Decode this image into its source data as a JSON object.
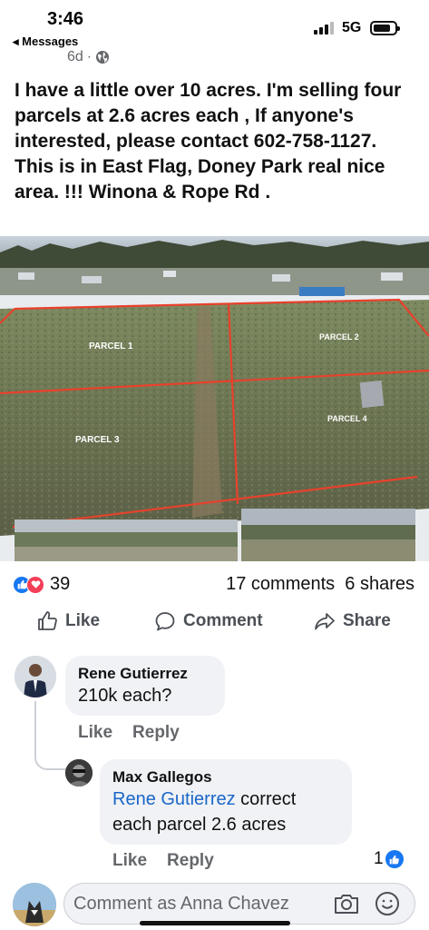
{
  "status_bar": {
    "time": "3:46",
    "back_label": "◂ Messages",
    "network": "5G"
  },
  "post": {
    "age": "6d",
    "separator": "·",
    "text": "I have a little over 10 acres. I'm selling four parcels at 2.6 acres each , If anyone's interested, please contact 602-758-1127. This is in East Flag, Doney Park real nice area. !!! Winona & Rope Rd .",
    "photo_labels": {
      "parcel1": "PARCEL 1",
      "parcel2": "PARCEL 2",
      "parcel3": "PARCEL 3",
      "parcel4": "PARCEL 4"
    },
    "reaction_count": "39",
    "comments_shares": "17 comments  6 shares"
  },
  "actions": {
    "like": "Like",
    "comment": "Comment",
    "share": "Share"
  },
  "comments": [
    {
      "name": "Rene Gutierrez",
      "text": "210k each?",
      "like": "Like",
      "reply": "Reply"
    },
    {
      "name": "Max Gallegos",
      "mention": "Rene Gutierrez",
      "text_after_mention": " correct",
      "text_line2": "each parcel 2.6 acres",
      "like": "Like",
      "reply": "Reply",
      "like_count": "1"
    }
  ],
  "composer": {
    "placeholder": "Comment as Anna Chavez"
  },
  "colors": {
    "accent_blue": "#1877f2",
    "love_red": "#f33e58",
    "parcel_line": "#e8412c"
  },
  "icons": [
    "globe-icon",
    "like-reaction-icon",
    "love-reaction-icon",
    "thumbs-up-icon",
    "speech-bubble-icon",
    "share-arrow-icon",
    "camera-icon",
    "smiley-icon",
    "signal-icon",
    "battery-icon"
  ]
}
